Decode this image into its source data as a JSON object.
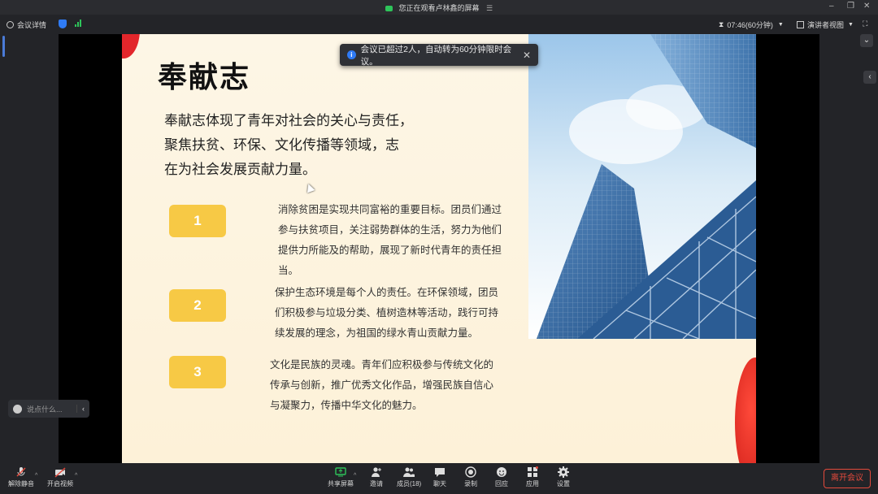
{
  "titlebar": {
    "title": "您正在观看卢林鑫的屏幕",
    "menu_icon": "list-icon",
    "window_controls": [
      "minimize-icon",
      "restore-icon",
      "close-icon"
    ]
  },
  "topbar": {
    "meeting_details": "会议详情",
    "timer": "07:46(60分钟)",
    "view_mode": "演讲者视图"
  },
  "toast": {
    "message": "会议已超过2人，自动转为60分钟限时会议。",
    "close": "✕"
  },
  "slide": {
    "title": "奉献志",
    "intro": [
      "奉献志体现了青年对社会的关心与责任，",
      "聚焦扶贫、环保、文化传播等领域，志",
      "在为社会发展贡献力量。"
    ],
    "items": [
      {
        "number": "1",
        "lines": [
          "消除贫困是实现共同富裕的重要目标。团员们通过",
          "参与扶贫项目，关注弱势群体的生活，努力为他们",
          "提供力所能及的帮助，展现了新时代青年的责任担",
          "当。"
        ]
      },
      {
        "number": "2",
        "lines": [
          "保护生态环境是每个人的责任。在环保领域，团员",
          "们积极参与垃圾分类、植树造林等活动，践行可持",
          "续发展的理念，为祖国的绿水青山贡献力量。"
        ]
      },
      {
        "number": "3",
        "lines": [
          "文化是民族的灵魂。青年们应积极参与传统文化的",
          "传承与创新，推广优秀文化作品，增强民族自信心",
          "与凝聚力，传播中华文化的魅力。"
        ]
      }
    ]
  },
  "chat": {
    "placeholder": "说点什么..."
  },
  "toolbar": {
    "mute": "解除静音",
    "video": "开启视频",
    "share": "共享屏幕",
    "invite": "邀请",
    "members": "成员(18)",
    "chat": "聊天",
    "record": "录制",
    "reaction": "回应",
    "apps": "应用",
    "settings": "设置",
    "leave": "离开会议"
  },
  "colors": {
    "accent": "#2f7bf5",
    "number_box": "#f7c945",
    "leave": "#e34a3c",
    "signal": "#2ec45a"
  }
}
